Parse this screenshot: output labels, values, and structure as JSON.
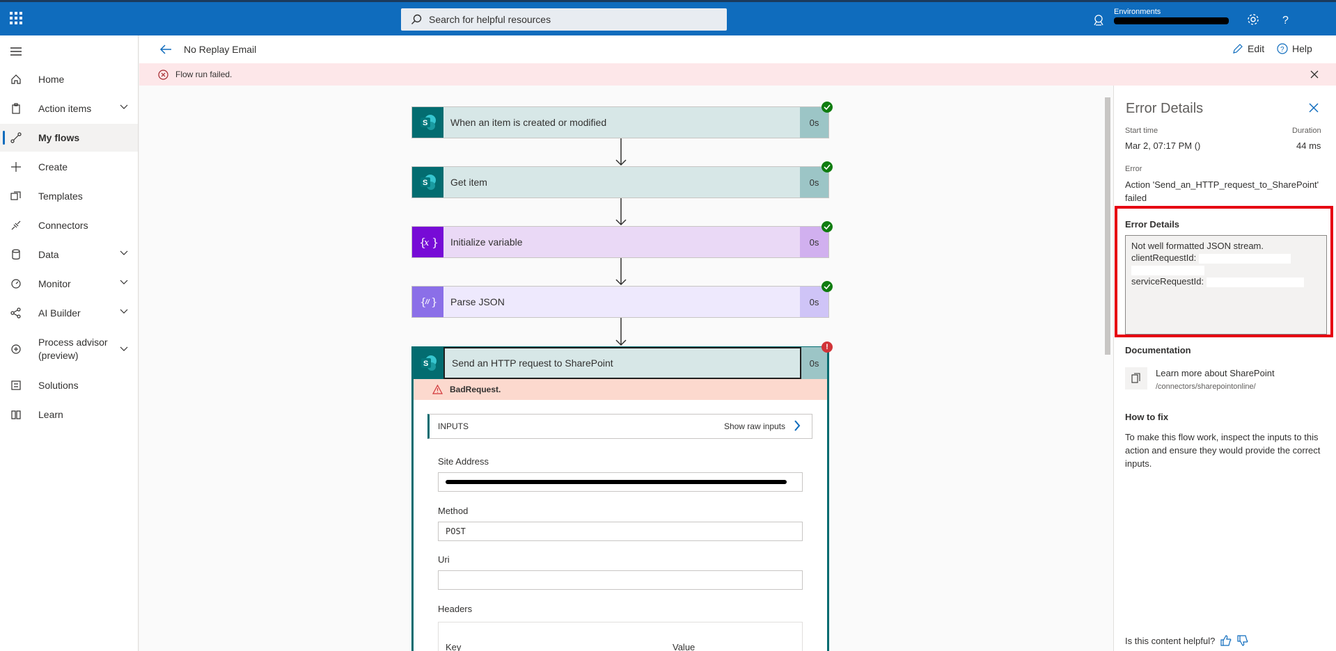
{
  "topbar": {
    "search_placeholder": "Search for helpful resources",
    "environments_label": "Environments"
  },
  "sidebar": {
    "items": [
      {
        "label": "Home"
      },
      {
        "label": "Action items"
      },
      {
        "label": "My flows"
      },
      {
        "label": "Create"
      },
      {
        "label": "Templates"
      },
      {
        "label": "Connectors"
      },
      {
        "label": "Data"
      },
      {
        "label": "Monitor"
      },
      {
        "label": "AI Builder"
      },
      {
        "label": "Process advisor"
      },
      {
        "label": "Solutions"
      },
      {
        "label": "Learn"
      }
    ],
    "process_advisor_sub": "(preview)"
  },
  "header": {
    "title": "No Replay Email",
    "edit_label": "Edit",
    "help_label": "Help"
  },
  "banner": {
    "text": "Flow run failed."
  },
  "flow": {
    "steps": [
      {
        "label": "When an item is created or modified",
        "duration": "0s"
      },
      {
        "label": "Get item",
        "duration": "0s"
      },
      {
        "label": "Initialize variable",
        "duration": "0s"
      },
      {
        "label": "Parse JSON",
        "duration": "0s"
      },
      {
        "label": "Send an HTTP request to SharePoint",
        "duration": "0s"
      }
    ],
    "error_status": "BadRequest.",
    "inputs_title": "INPUTS",
    "show_raw": "Show raw inputs",
    "fields": {
      "site_address_label": "Site Address",
      "method_label": "Method",
      "method_value": "POST",
      "uri_label": "Uri",
      "uri_value": "",
      "headers_label": "Headers",
      "key_col": "Key",
      "value_col": "Value"
    }
  },
  "panel": {
    "title": "Error Details",
    "start_time_label": "Start time",
    "start_time_value": "Mar 2, 07:17 PM ()",
    "duration_label": "Duration",
    "duration_value": "44 ms",
    "error_label": "Error",
    "error_value": "Action 'Send_an_HTTP_request_to_SharePoint' failed",
    "error_details_title": "Error Details",
    "error_line1": "Not well formatted JSON stream.",
    "error_line2": "clientRequestId:",
    "error_line3": "serviceRequestId:",
    "documentation_title": "Documentation",
    "doc_link": "Learn more about SharePoint",
    "doc_path": "/connectors/sharepointonline/",
    "how_to_fix_title": "How to fix",
    "how_to_fix_text": "To make this flow work, inspect the inputs to this action and ensure they would provide the correct inputs.",
    "helpful_question": "Is this content helpful?"
  },
  "colors": {
    "brand_blue": "#0f6cbd",
    "sharepoint": "#036c70",
    "variable": "#770bd6",
    "json": "#8b6fe8",
    "success": "#107c10",
    "error": "#d13438",
    "highlight_box": "#e60012"
  }
}
